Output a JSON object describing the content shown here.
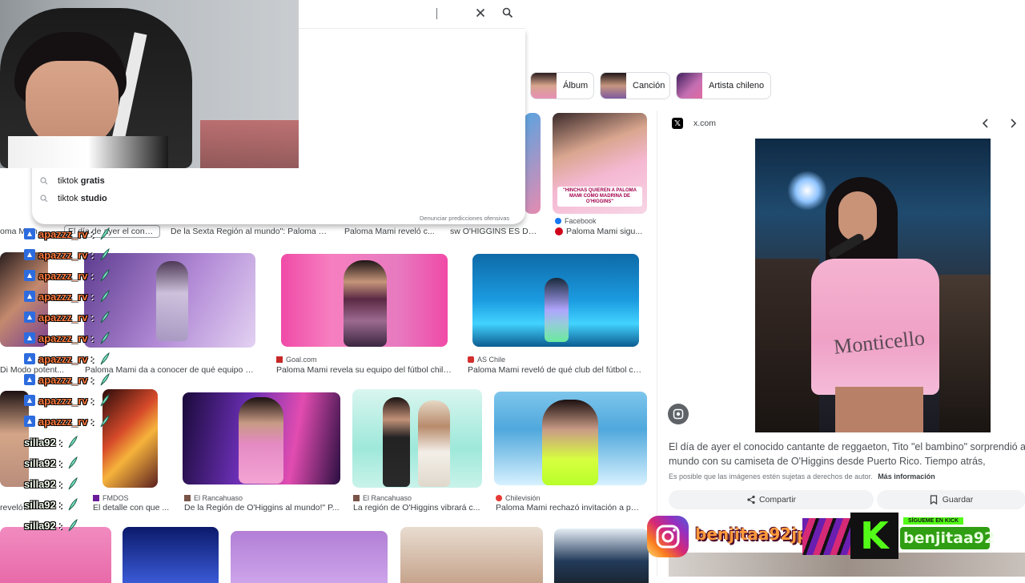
{
  "search": {
    "clear_icon": "close-icon",
    "search_icon": "search-icon",
    "suggestions": [
      {
        "prefix": "tiktok ",
        "bold": "gratis"
      },
      {
        "prefix": "tiktok ",
        "bold": "studio"
      }
    ],
    "report_link": "Denunciar predicciones ofensivas"
  },
  "chips": [
    {
      "label": "Álbum"
    },
    {
      "label": "Canción"
    },
    {
      "label": "Artista chileno"
    }
  ],
  "results_row1": {
    "captions": [
      {
        "title": "oma Mam..."
      },
      {
        "title": "El día de ayer el conoc..."
      },
      {
        "title": "De la Sexta Región al mundo\": Paloma M..."
      },
      {
        "title": "Paloma Mami reveló c..."
      },
      {
        "title": "sw O'HIGGINS ES DE ..."
      }
    ],
    "facebook_card": {
      "source": "Facebook",
      "title": "Paloma Mami sigu...",
      "image_banner": "\"HINCHAS QUIEREN A PALOMA MAMI COMO MADRINA DE O'HIGGINS\""
    }
  },
  "results_row2": [
    {
      "source": "",
      "title": "Di Modo potent..."
    },
    {
      "source": "",
      "title": "Paloma Mami da a conocer de qué equipo chil..."
    },
    {
      "source": "Goal.com",
      "title": "Paloma Mami revela su equipo del fútbol chilen..."
    },
    {
      "source": "AS Chile",
      "title": "Paloma Mami reveló de qué club del fútbol chil..."
    }
  ],
  "results_row3": [
    {
      "source": "",
      "title": "reveló c..."
    },
    {
      "source": "FMDOS",
      "title": "El detalle con que ..."
    },
    {
      "source": "El Rancahuaso",
      "title": "De la Región de O'Higgins al mundo!\" P..."
    },
    {
      "source": "El Rancahuaso",
      "title": "La región de O'Higgins vibrará c..."
    },
    {
      "source": "Chilevisión",
      "title": "Paloma Mami rechazó invitación a parti..."
    }
  ],
  "side_panel": {
    "site": "x.com",
    "shirt_text": "Monticello",
    "description": "El día de ayer el conocido cantante de reggaeton, Tito \"el bambino\" sorprendió a mundo con su camiseta de O'Higgins desde Puerto Rico. Tiempo atrás, Paloma...",
    "copyright": "Es posible que las imágenes estén sujetas a derechos de autor.",
    "more_info": "Más información",
    "share_label": "Compartir",
    "save_label": "Guardar"
  },
  "chat": {
    "messages": [
      {
        "user": "apazzz_rv",
        "colon": ":"
      },
      {
        "user": "apazzz_rv",
        "colon": ":"
      },
      {
        "user": "apazzz_rv",
        "colon": ":"
      },
      {
        "user": "apazzz_rv",
        "colon": ":"
      },
      {
        "user": "apazzz_rv",
        "colon": ":"
      },
      {
        "user": "apazzz_rv",
        "colon": ":"
      },
      {
        "user": "apazzz_rv",
        "colon": ":"
      },
      {
        "user": "apazzz_rv",
        "colon": ":"
      },
      {
        "user": "apazzz_rv",
        "colon": ":"
      },
      {
        "user": "apazzz_rv",
        "colon": ":"
      },
      {
        "user": "silla92",
        "colon": ":"
      },
      {
        "user": "silla92",
        "colon": ":"
      },
      {
        "user": "silla92",
        "colon": ":"
      },
      {
        "user": "silla92",
        "colon": ":"
      },
      {
        "user": "silla92",
        "colon": ":"
      }
    ]
  },
  "social": {
    "instagram_handle": "benjitaa92jp",
    "kick_tag": "SÍGUEME EN KICK",
    "kick_handle": "benjitaa92"
  },
  "colors": {
    "instagram": "#d6249f",
    "kick": "#53fc18",
    "chat_name": "#ff7a3d"
  }
}
